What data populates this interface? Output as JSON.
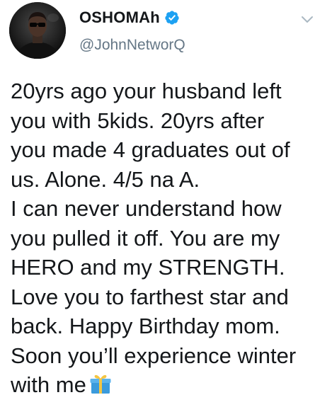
{
  "tweet": {
    "display_name": "OSHOMAh",
    "handle": "@JohnNetworQ",
    "verified": true,
    "lines": [
      "20yrs ago your husband left",
      "you with 5kids. 20yrs after",
      "you made 4 graduates out of",
      "us. Alone. 4/5 na A.",
      "I can never understand how",
      "you pulled it off. You are my",
      "HERO and my STRENGTH.",
      "Love you to farthest star and",
      "back. Happy Birthday mom.",
      "Soon you’ll experience winter",
      "with me"
    ],
    "emoji": "gift-icon"
  },
  "colors": {
    "verified_blue": "#1da1f2",
    "handle_gray": "#657786",
    "text_dark": "#14171a",
    "gift_blue": "#3b9bdc",
    "gift_ribbon": "#f4c542"
  }
}
